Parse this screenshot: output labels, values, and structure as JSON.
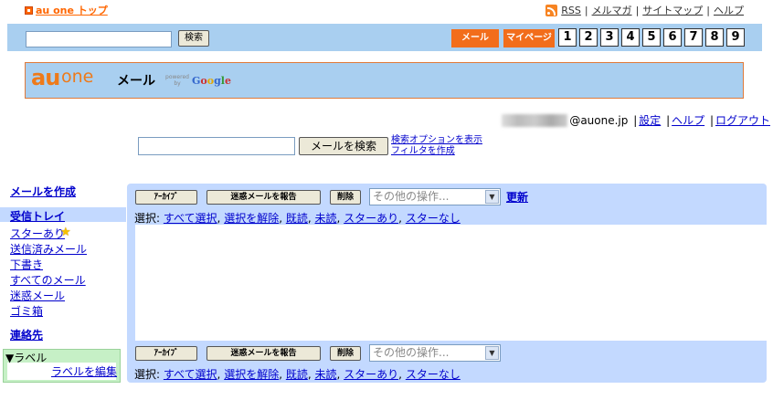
{
  "top": {
    "au_top": "au one トップ",
    "links": [
      "RSS",
      "メルマガ",
      "サイトマップ",
      "ヘルプ"
    ]
  },
  "header": {
    "search_button": "検索",
    "mail_tab": "メール",
    "mypage_tab": "マイページ",
    "pages": [
      "1",
      "2",
      "3",
      "4",
      "5",
      "6",
      "7",
      "8",
      "9"
    ]
  },
  "logo": {
    "au": "au",
    "one": "one",
    "mail": "メール",
    "powered": "powered by",
    "google": [
      "G",
      "o",
      "o",
      "g",
      "l",
      "e"
    ],
    "google_colors": [
      "#3366cc",
      "#cc3333",
      "#e5a800",
      "#3366cc",
      "#339933",
      "#cc3333"
    ]
  },
  "user": {
    "email_suffix": "@auone.jp",
    "settings": "設定",
    "help": "ヘルプ",
    "logout": "ログアウト"
  },
  "search": {
    "button": "メールを検索",
    "show_options": "検索オプションを表示",
    "create_filter": "フィルタを作成"
  },
  "sidebar": {
    "compose": "メールを作成",
    "inbox": "受信トレイ",
    "items": [
      "スターあり",
      "送信済みメール",
      "下書き",
      "すべてのメール",
      "迷惑メール",
      "ゴミ箱"
    ],
    "contacts": "連絡先",
    "labels_title": "▼ラベル",
    "edit_labels": "ラベルを編集"
  },
  "toolbar": {
    "archive": "ｱｰｶｲﾌﾞ",
    "report_spam": "迷惑メールを報告",
    "delete": "削除",
    "more_actions": "その他の操作...",
    "refresh": "更新"
  },
  "select_row": {
    "prefix": "選択: ",
    "options": [
      "すべて選択",
      "選択を解除",
      "既読",
      "未読",
      "スターあり",
      "スターなし"
    ]
  }
}
